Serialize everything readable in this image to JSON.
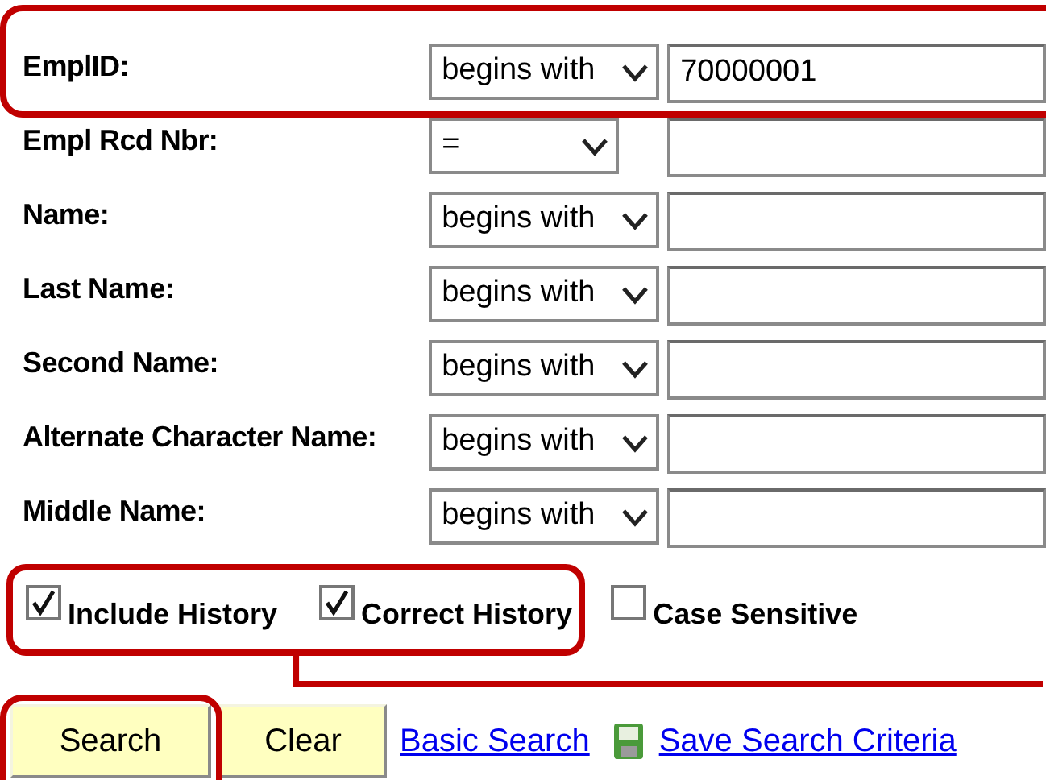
{
  "fields": [
    {
      "label": "EmplID:",
      "operator": "begins with",
      "value": "70000001",
      "highlighted": true
    },
    {
      "label": "Empl Rcd Nbr:",
      "operator": "=",
      "highlighted": false
    },
    {
      "label": "Name:",
      "operator": "begins with",
      "highlighted": false
    },
    {
      "label": "Last Name:",
      "operator": "begins with",
      "highlighted": false
    },
    {
      "label": "Second Name:",
      "operator": "begins with",
      "highlighted": false
    },
    {
      "label": "Alternate Character Name:",
      "operator": "begins with",
      "highlighted": false
    },
    {
      "label": "Middle Name:",
      "operator": "begins with",
      "highlighted": false
    }
  ],
  "option_groups": [
    {
      "highlighted": true,
      "options": [
        {
          "label": "Include History",
          "checked": true
        },
        {
          "label": "Correct History",
          "checked": true
        }
      ]
    },
    {
      "highlighted": false,
      "options": [
        {
          "label": "Case Sensitive",
          "checked": false
        }
      ]
    }
  ],
  "buttons": [
    {
      "label": "Search",
      "highlighted": true
    },
    {
      "label": "Clear",
      "highlighted": false
    }
  ],
  "links": [
    {
      "label": "Basic Search",
      "kind": "plain"
    },
    {
      "label": "Save Search Criteria",
      "kind": "save"
    }
  ]
}
